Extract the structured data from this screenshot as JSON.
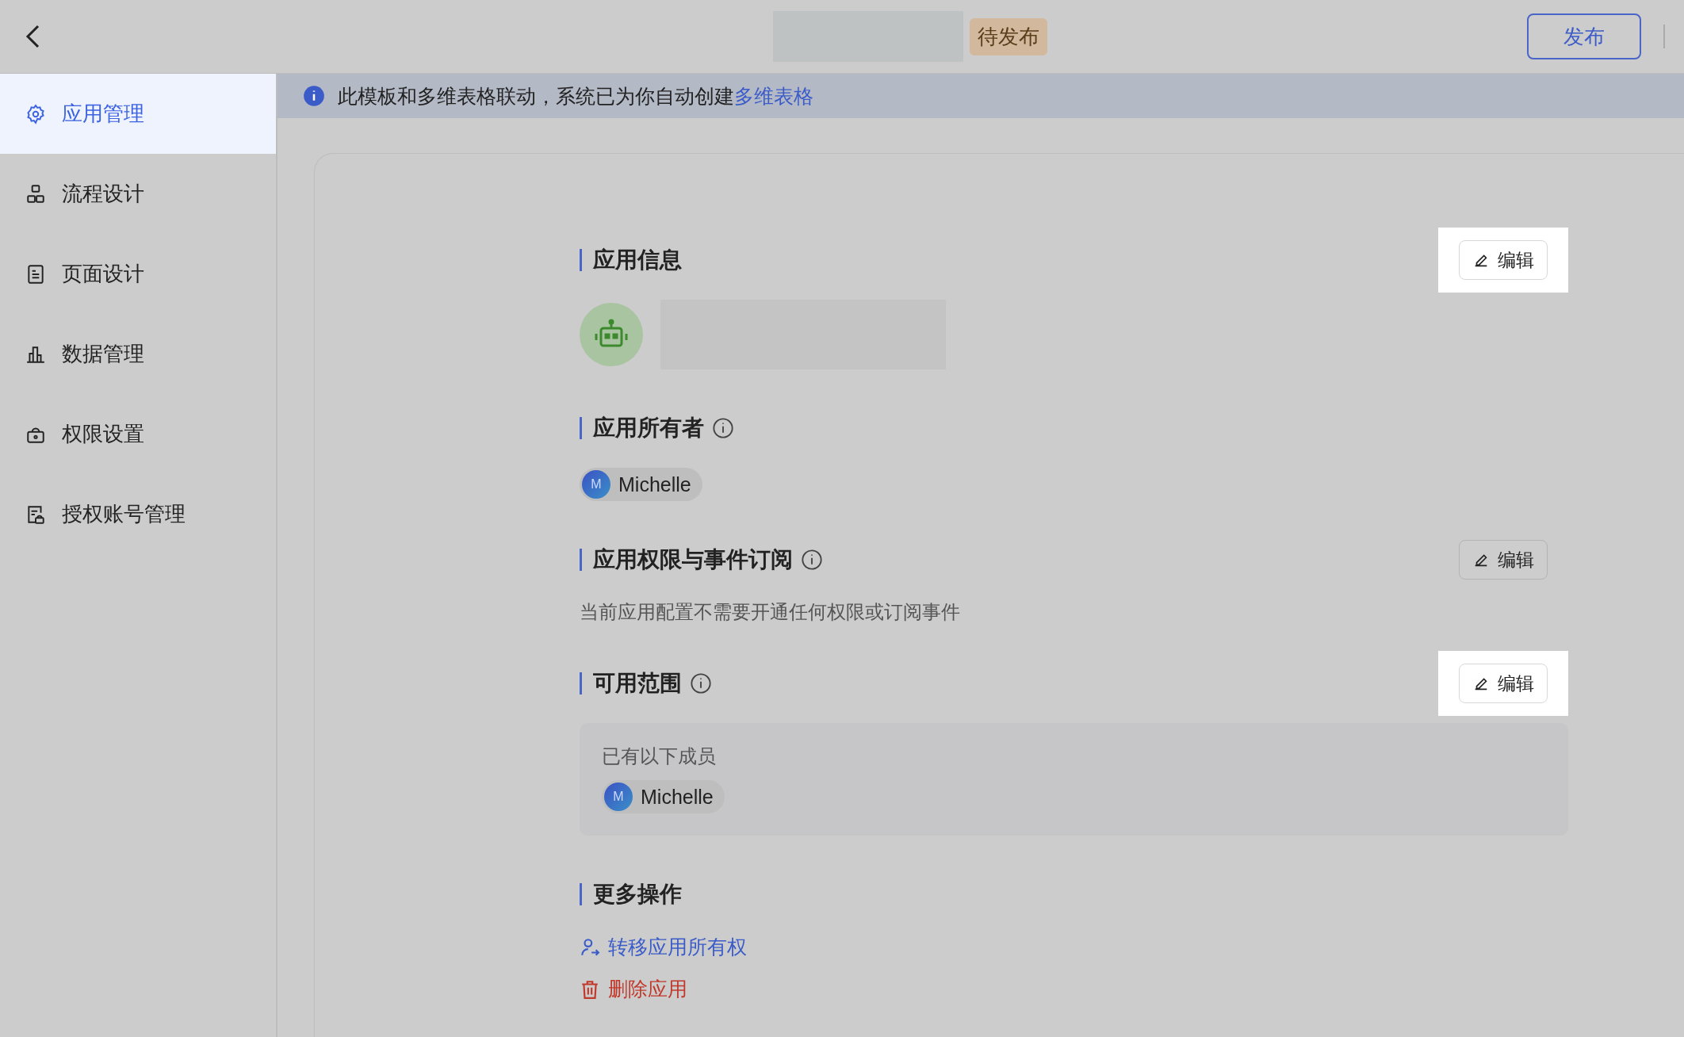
{
  "header": {
    "status": "待发布",
    "publish_button": "发布"
  },
  "sidebar": {
    "items": [
      {
        "label": "应用管理",
        "selected": true
      },
      {
        "label": "流程设计",
        "selected": false
      },
      {
        "label": "页面设计",
        "selected": false
      },
      {
        "label": "数据管理",
        "selected": false
      },
      {
        "label": "权限设置",
        "selected": false
      },
      {
        "label": "授权账号管理",
        "selected": false
      }
    ]
  },
  "banner": {
    "text": "此模板和多维表格联动，系统已为你自动创建",
    "link": "多维表格"
  },
  "sections": [
    {
      "kind": "app_info",
      "title": "应用信息",
      "edit": {
        "label": "编辑",
        "highlighted": true
      }
    },
    {
      "kind": "owner",
      "title": "应用所有者",
      "members": [
        {
          "initial": "M",
          "name": "Michelle"
        }
      ]
    },
    {
      "kind": "permissions",
      "title": "应用权限与事件订阅",
      "description": "当前应用配置不需要开通任何权限或订阅事件",
      "edit": {
        "label": "编辑",
        "highlighted": false
      }
    },
    {
      "kind": "scope",
      "title": "可用范围",
      "note": "已有以下成员",
      "members": [
        {
          "initial": "M",
          "name": "Michelle"
        }
      ],
      "edit": {
        "label": "编辑",
        "highlighted": true
      }
    },
    {
      "kind": "actions",
      "title": "更多操作",
      "actions": [
        {
          "label": "转移应用所有权",
          "kind": "transfer"
        },
        {
          "label": "删除应用",
          "kind": "delete"
        }
      ]
    }
  ]
}
